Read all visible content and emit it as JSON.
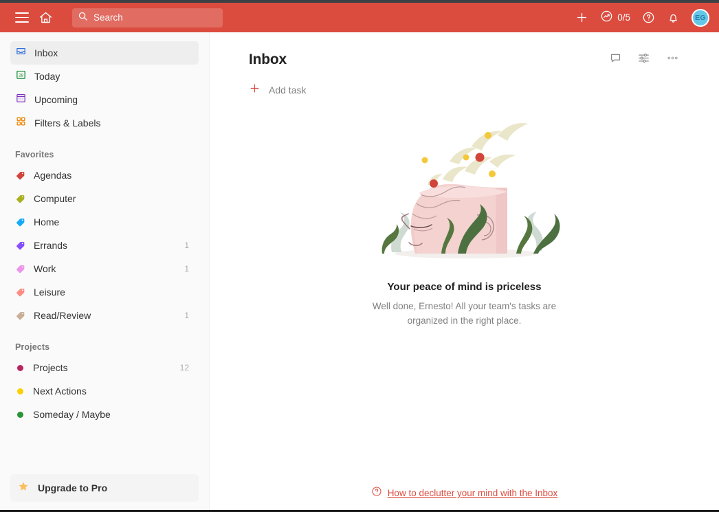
{
  "header": {
    "menu_icon": "hamburger-icon",
    "home_icon": "home-icon",
    "search": {
      "placeholder": "Search",
      "value": "Search",
      "icon": "search-icon"
    },
    "add_icon": "plus-icon",
    "productivity": {
      "icon": "productivity-chart-icon",
      "count": "0/5"
    },
    "help_icon": "question-mark-icon",
    "notifications_icon": "bell-icon",
    "avatar": {
      "initials": "EG",
      "name": "avatar"
    },
    "bg_color": "#db4c3f"
  },
  "sidebar": {
    "nav": [
      {
        "label": "Inbox",
        "icon": "inbox-icon",
        "color": "#2f6fdb",
        "active": true,
        "count": ""
      },
      {
        "label": "Today",
        "icon": "today-calendar-icon",
        "color": "#058527",
        "active": false,
        "count": ""
      },
      {
        "label": "Upcoming",
        "icon": "upcoming-calendar-icon",
        "color": "#7b2fbd",
        "active": false,
        "count": ""
      },
      {
        "label": "Filters & Labels",
        "icon": "filters-labels-icon",
        "color": "#eb8909",
        "active": false,
        "count": ""
      }
    ],
    "favorites_heading": "Favorites",
    "favorites": [
      {
        "label": "Agendas",
        "icon": "label-tag-icon",
        "color": "#d1453b",
        "count": ""
      },
      {
        "label": "Computer",
        "icon": "label-tag-icon",
        "color": "#a9b021",
        "count": ""
      },
      {
        "label": "Home",
        "icon": "label-tag-icon",
        "color": "#14aaf5",
        "count": ""
      },
      {
        "label": "Errands",
        "icon": "label-tag-icon",
        "color": "#884dff",
        "count": "1"
      },
      {
        "label": "Work",
        "icon": "label-tag-icon",
        "color": "#eb96eb",
        "count": "1"
      },
      {
        "label": "Leisure",
        "icon": "label-tag-icon",
        "color": "#ff8d85",
        "count": ""
      },
      {
        "label": "Read/Review",
        "icon": "label-tag-icon",
        "color": "#c9af97",
        "count": "1"
      }
    ],
    "projects_heading": "Projects",
    "projects": [
      {
        "label": "Projects",
        "icon": "project-dot-icon",
        "color": "#b8255f",
        "count": "12"
      },
      {
        "label": "Next Actions",
        "icon": "project-dot-icon",
        "color": "#fad000",
        "count": ""
      },
      {
        "label": "Someday / Maybe",
        "icon": "project-dot-icon",
        "color": "#299438",
        "count": ""
      }
    ],
    "upgrade": {
      "label": "Upgrade to Pro",
      "icon": "star-icon",
      "color": "#fbbe5d"
    }
  },
  "main": {
    "title": "Inbox",
    "actions": [
      {
        "name": "comments-icon"
      },
      {
        "name": "view-options-icon"
      },
      {
        "name": "more-options-icon"
      }
    ],
    "add_task": {
      "label": "Add task",
      "icon": "plus-icon",
      "color": "#db4c3f"
    },
    "empty_state": {
      "title": "Your peace of mind is priceless",
      "subtitle": "Well done, Ernesto! All your team's tasks are organized in the right place.",
      "illustration": "peace-of-mind-head-illustration"
    },
    "help_link": {
      "label": "How to declutter your mind with the Inbox",
      "icon": "question-mark-icon",
      "color": "#db4c3f"
    }
  }
}
